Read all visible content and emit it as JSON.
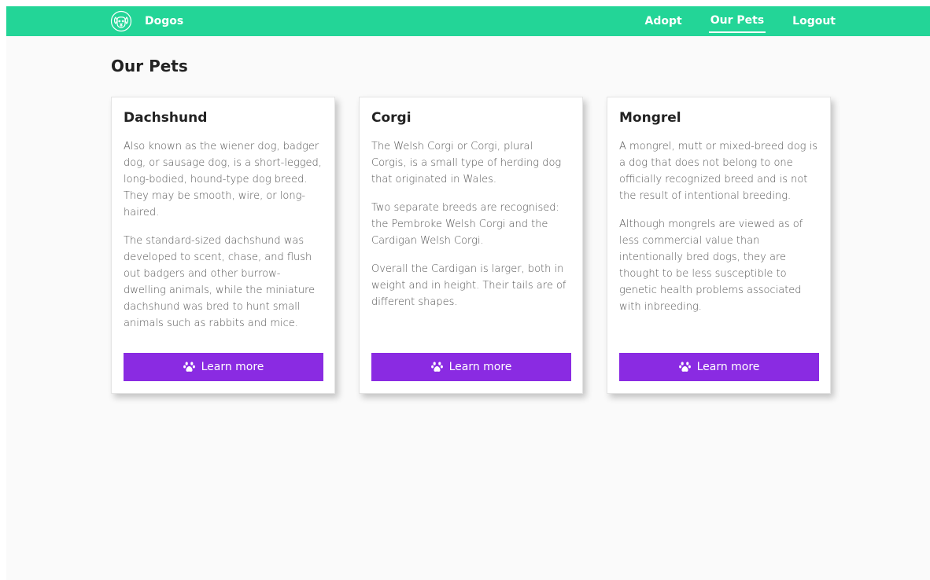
{
  "brand": {
    "name": "Dogos",
    "icon": "dog-face-icon"
  },
  "nav": {
    "links": [
      {
        "label": "Adopt",
        "active": false
      },
      {
        "label": "Our Pets",
        "active": true
      },
      {
        "label": "Logout",
        "active": false
      }
    ]
  },
  "page": {
    "title": "Our Pets"
  },
  "cards": [
    {
      "title": "Dachshund",
      "paragraphs": [
        "Also known as the wiener dog, badger dog, or sausage dog, is a short-legged, long-bodied, hound-type dog breed. They may be smooth, wire, or long-haired.",
        "The standard-sized dachshund was developed to scent, chase, and flush out badgers and other burrow-dwelling animals, while the miniature dachshund was bred to hunt small animals such as rabbits and mice."
      ],
      "button": "Learn more"
    },
    {
      "title": "Corgi",
      "paragraphs": [
        "The Welsh Corgi or Corgi, plural Corgis, is a small type of herding dog that originated in Wales.",
        "Two separate breeds are recognised: the Pembroke Welsh Corgi and the Cardigan Welsh Corgi.",
        "Overall the Cardigan is larger, both in weight and in height. Their tails are of different shapes."
      ],
      "button": "Learn more"
    },
    {
      "title": "Mongrel",
      "paragraphs": [
        "A mongrel, mutt or mixed-breed dog is a dog that does not belong to one officially recognized breed and is not the result of intentional breeding.",
        "Although mongrels are viewed as of less commercial value than intentionally bred dogs, they are thought to be less susceptible to genetic health problems associated with inbreeding."
      ],
      "button": "Learn more"
    }
  ],
  "colors": {
    "navbar": "#23d597",
    "button": "#8a2be2",
    "background": "#fafafa"
  }
}
